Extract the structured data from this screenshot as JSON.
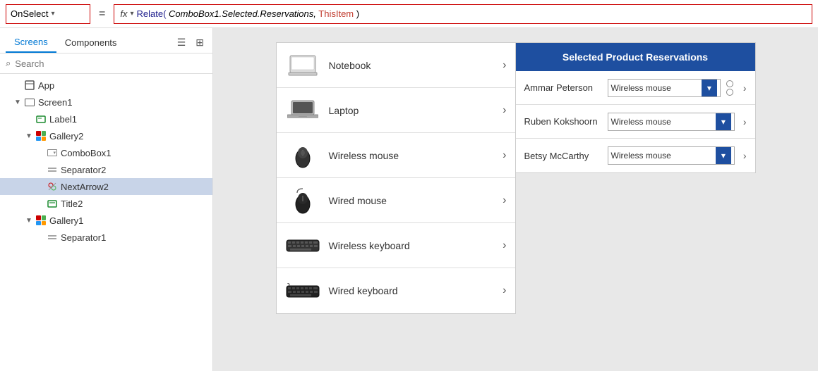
{
  "topbar": {
    "property": "OnSelect",
    "formula": "Relate( ComboBox1.Selected.Reservations, ThisItem )",
    "formula_parts": {
      "fn": "Relate(",
      "param1": " ComboBox1.Selected.Reservations,",
      "space": " ",
      "param2": "ThisItem",
      "close": " )"
    },
    "fx_label": "fx"
  },
  "left_panel": {
    "tabs": [
      {
        "label": "Screens",
        "active": true
      },
      {
        "label": "Components",
        "active": false
      }
    ],
    "search_placeholder": "Search",
    "tree_items": [
      {
        "label": "App",
        "indent": 1,
        "type": "app",
        "expanded": false
      },
      {
        "label": "Screen1",
        "indent": 1,
        "type": "screen",
        "expanded": true,
        "has_expand": true
      },
      {
        "label": "Label1",
        "indent": 2,
        "type": "label"
      },
      {
        "label": "Gallery2",
        "indent": 2,
        "type": "gallery",
        "expanded": true,
        "has_expand": true
      },
      {
        "label": "ComboBox1",
        "indent": 3,
        "type": "combobox"
      },
      {
        "label": "Separator2",
        "indent": 3,
        "type": "separator"
      },
      {
        "label": "NextArrow2",
        "indent": 3,
        "type": "nextarrow",
        "selected": true
      },
      {
        "label": "Title2",
        "indent": 3,
        "type": "title"
      },
      {
        "label": "Gallery1",
        "indent": 2,
        "type": "gallery",
        "expanded": true,
        "has_expand": true
      },
      {
        "label": "Separator1",
        "indent": 3,
        "type": "separator"
      }
    ]
  },
  "products": {
    "panel_items": [
      {
        "name": "Notebook",
        "type": "notebook"
      },
      {
        "name": "Laptop",
        "type": "laptop"
      },
      {
        "name": "Wireless mouse",
        "type": "wmouse"
      },
      {
        "name": "Wired mouse",
        "type": "wiredmouse"
      },
      {
        "name": "Wireless keyboard",
        "type": "wkeyboard"
      },
      {
        "name": "Wired keyboard",
        "type": "wiredkeyboard"
      }
    ]
  },
  "reservations": {
    "title": "Selected Product Reservations",
    "rows": [
      {
        "name": "Ammar Peterson",
        "value": "Wireless mouse"
      },
      {
        "name": "Ruben Kokshoorn",
        "value": "Wireless mouse"
      },
      {
        "name": "Betsy McCarthy",
        "value": "Wireless mouse"
      }
    ]
  }
}
